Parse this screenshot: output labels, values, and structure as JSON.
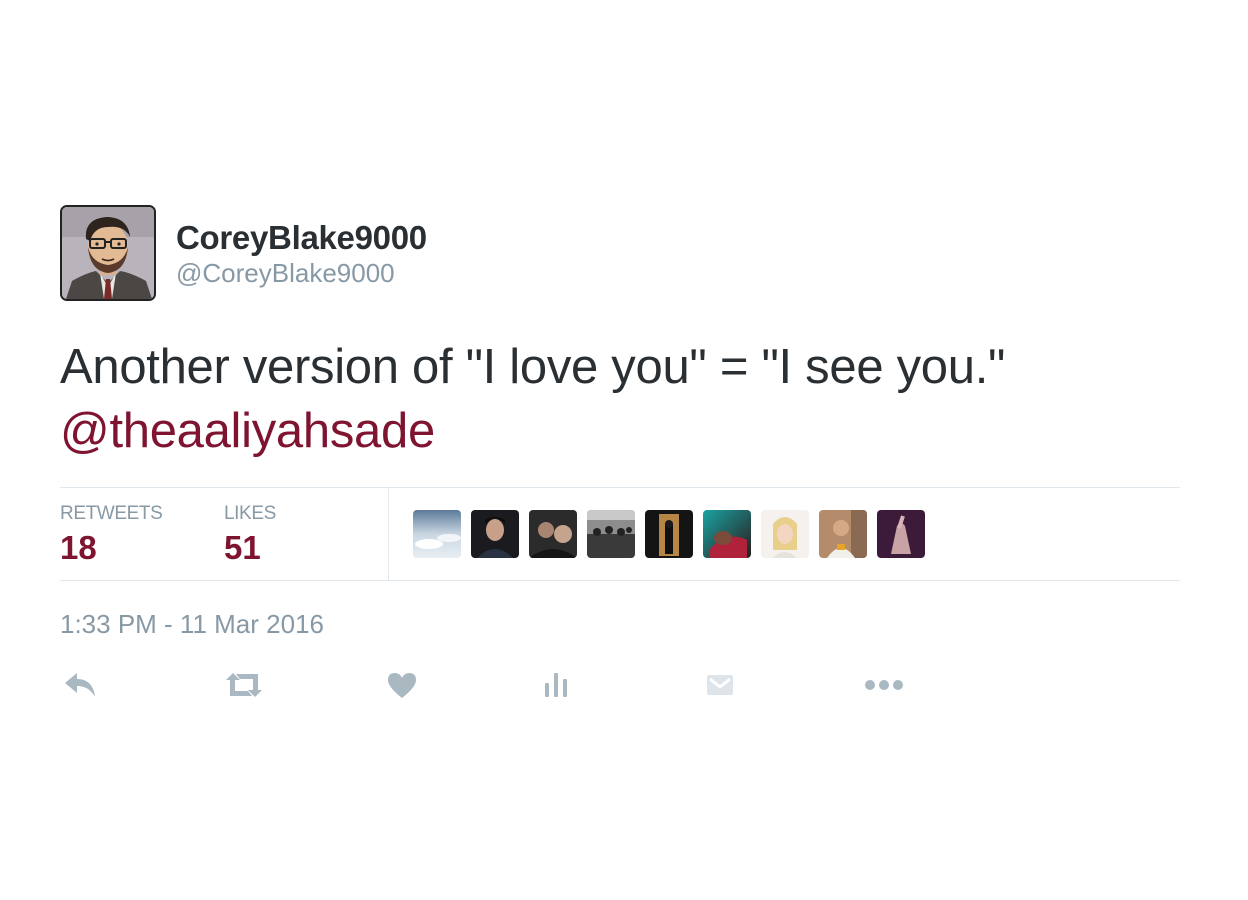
{
  "tweet": {
    "display_name": "CoreyBlake9000",
    "handle": "@CoreyBlake9000",
    "text": "Another version of \"I love you\" = \"I see you.\"",
    "mention": "@theaaliyahsade",
    "timestamp": "1:33 PM - 11 Mar 2016"
  },
  "stats": {
    "retweets_label": "RETWEETS",
    "retweets_count": "18",
    "likes_label": "LIKES",
    "likes_count": "51"
  },
  "actions": [
    "reply-icon",
    "retweet-icon",
    "heart-icon",
    "analytics-icon",
    "dm-icon",
    "more-icon"
  ],
  "colors": {
    "accent": "#7f1431",
    "muted": "#8899a6",
    "text": "#292f33",
    "icon": "#aab8c2",
    "divider": "#e1e8ed"
  }
}
